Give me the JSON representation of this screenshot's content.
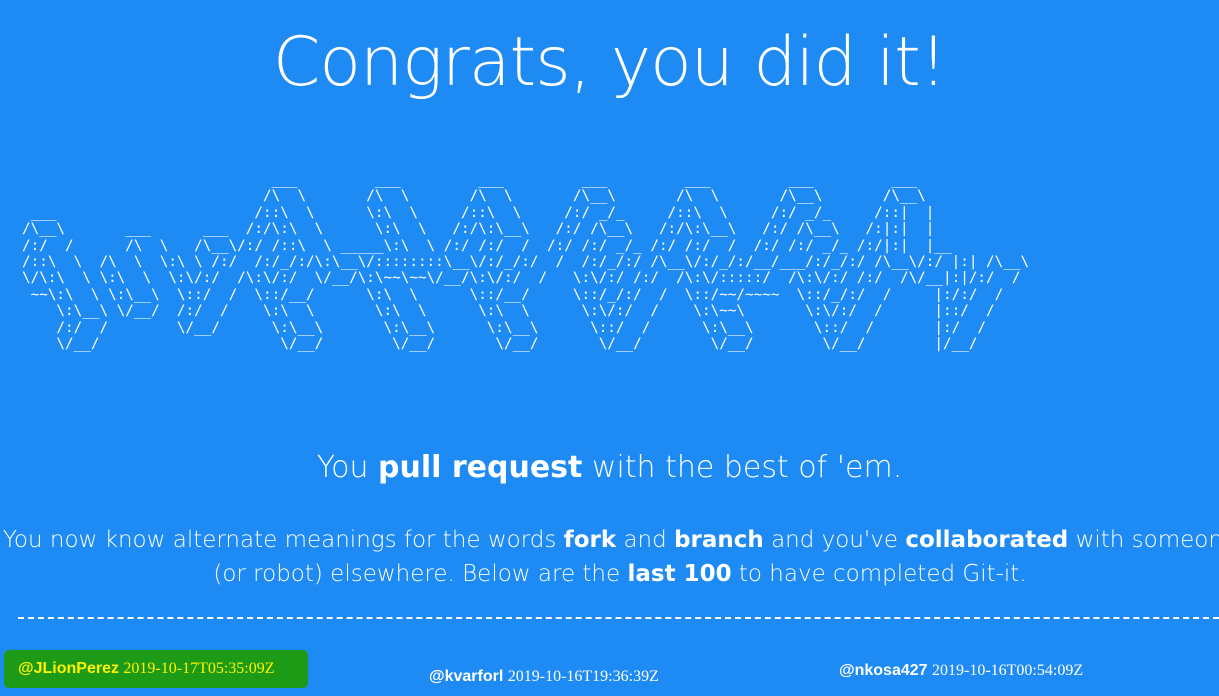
{
  "headline": "Congrats, you did it!",
  "tagline": {
    "pre": "You ",
    "bold": "pull request",
    "post": " with the best of 'em."
  },
  "description": {
    "p1": "You now know alternate meanings for the words ",
    "b1": "fork",
    "p2": " and ",
    "b2": "branch",
    "p3": " and you've ",
    "b3": "collaborated",
    "p4": " with someone (or robot) elsewhere. Below are the ",
    "b4": "last 100",
    "p5": " to have completed Git-it."
  },
  "completions": [
    {
      "user": "@JLionPerez",
      "timestamp": "2019-10-17T05:35:09Z",
      "highlighted": true
    },
    {
      "user": "@kvarforl",
      "timestamp": "2019-10-16T19:36:39Z",
      "highlighted": false
    },
    {
      "user": "@nkosa427",
      "timestamp": "2019-10-16T00:54:09Z",
      "highlighted": false
    }
  ],
  "colors": {
    "background": "#1e8bf5",
    "highlight_bg": "#1d9b17",
    "highlight_text": "#fff200"
  }
}
